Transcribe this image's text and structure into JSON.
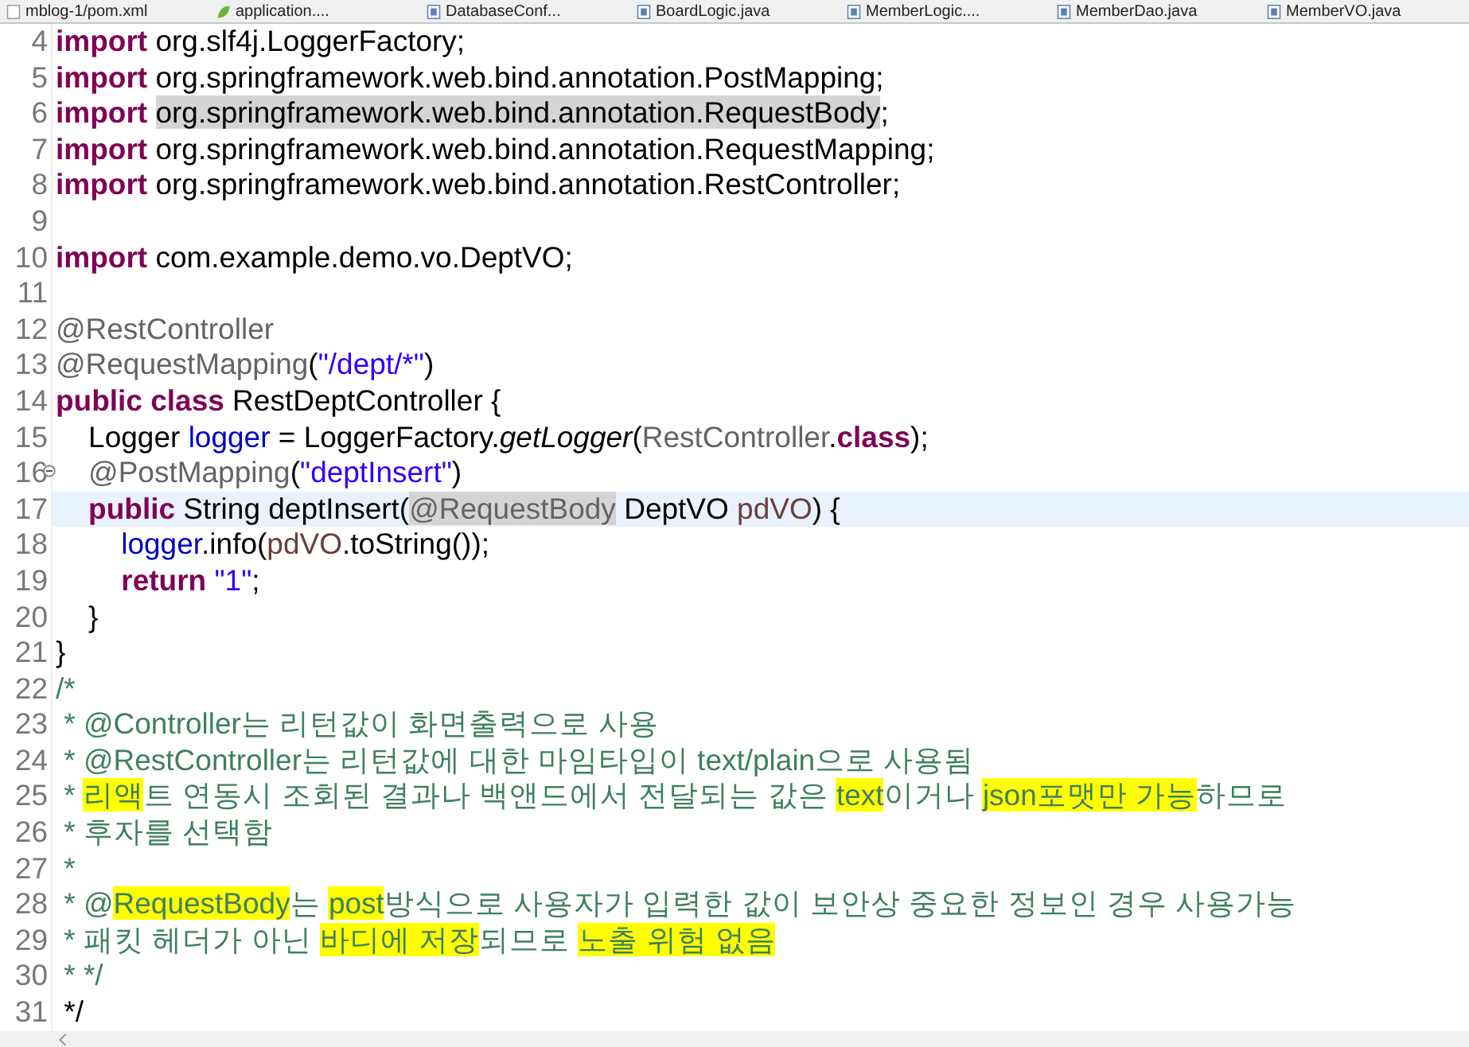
{
  "editor_tabs": [
    {
      "label": "mblog-1/pom.xml",
      "kind": "xml"
    },
    {
      "label": "application....",
      "kind": "spring"
    },
    {
      "label": "DatabaseConf...",
      "kind": "java"
    },
    {
      "label": "BoardLogic.java",
      "kind": "java"
    },
    {
      "label": "MemberLogic....",
      "kind": "java"
    },
    {
      "label": "MemberDao.java",
      "kind": "java"
    },
    {
      "label": "MemberVO.java",
      "kind": "java"
    }
  ],
  "code_lines": [
    {
      "number": "4",
      "current": false,
      "fold": false,
      "tokens": [
        {
          "text": "import ",
          "kind": "keyword"
        },
        {
          "text": "org.slf4j.LoggerFactory;",
          "kind": "plain"
        }
      ]
    },
    {
      "number": "5",
      "current": false,
      "fold": false,
      "tokens": [
        {
          "text": "import ",
          "kind": "keyword"
        },
        {
          "text": "org.springframework.web.bind.annotation.PostMapping;",
          "kind": "plain"
        }
      ]
    },
    {
      "number": "6",
      "current": false,
      "fold": false,
      "tokens": [
        {
          "text": "import ",
          "kind": "keyword"
        },
        {
          "text": "org.springframework.web.bind.annotation.RequestBody",
          "kind": "occurrence"
        },
        {
          "text": ";",
          "kind": "plain"
        }
      ]
    },
    {
      "number": "7",
      "current": false,
      "fold": false,
      "tokens": [
        {
          "text": "import ",
          "kind": "keyword"
        },
        {
          "text": "org.springframework.web.bind.annotation.RequestMapping;",
          "kind": "plain"
        }
      ]
    },
    {
      "number": "8",
      "current": false,
      "fold": false,
      "tokens": [
        {
          "text": "import ",
          "kind": "keyword"
        },
        {
          "text": "org.springframework.web.bind.annotation.RestController;",
          "kind": "plain"
        }
      ]
    },
    {
      "number": "9",
      "current": false,
      "fold": false
    },
    {
      "number": "10",
      "current": false,
      "fold": false,
      "tokens": [
        {
          "text": "import ",
          "kind": "keyword"
        },
        {
          "text": "com.example.demo.vo.DeptVO;",
          "kind": "plain"
        }
      ]
    },
    {
      "number": "11",
      "current": false,
      "fold": false
    },
    {
      "number": "12",
      "current": false,
      "fold": false,
      "tokens": [
        {
          "text": "@RestController",
          "kind": "annotation"
        }
      ]
    },
    {
      "number": "13",
      "current": false,
      "fold": false,
      "tokens": [
        {
          "text": "@RequestMapping",
          "kind": "annotation"
        },
        {
          "text": "(",
          "kind": "plain"
        },
        {
          "text": "\"/dept/*\"",
          "kind": "string"
        },
        {
          "text": ")",
          "kind": "plain"
        }
      ]
    },
    {
      "number": "14",
      "current": false,
      "fold": false,
      "tokens": [
        {
          "text": "public class",
          "kind": "keyword"
        },
        {
          "text": " RestDeptController {",
          "kind": "plain"
        }
      ]
    },
    {
      "number": "15",
      "current": false,
      "fold": false,
      "tokens": [
        {
          "text": "    Logger ",
          "kind": "plain"
        },
        {
          "text": "logger",
          "kind": "field"
        },
        {
          "text": " = LoggerFactory.",
          "kind": "plain"
        },
        {
          "text": "getLogger",
          "kind": "static"
        },
        {
          "text": "(",
          "kind": "plain"
        },
        {
          "text": "RestController",
          "kind": "annotation"
        },
        {
          "text": ".",
          "kind": "plain"
        },
        {
          "text": "class",
          "kind": "keyword"
        },
        {
          "text": ");",
          "kind": "plain"
        }
      ]
    },
    {
      "number": "16",
      "current": false,
      "fold": true,
      "tokens": [
        {
          "text": "    @PostMapping",
          "kind": "annotation"
        },
        {
          "text": "(",
          "kind": "plain"
        },
        {
          "text": "\"deptInsert\"",
          "kind": "string"
        },
        {
          "text": ")",
          "kind": "plain"
        }
      ]
    },
    {
      "number": "17",
      "current": true,
      "fold": false,
      "tokens": [
        {
          "text": "    public",
          "kind": "keyword"
        },
        {
          "text": " String deptInsert(",
          "kind": "plain"
        },
        {
          "text": "@RequestBody",
          "kind": "annotation-occurrence"
        },
        {
          "text": " DeptVO ",
          "kind": "plain"
        },
        {
          "text": "pdVO",
          "kind": "variable"
        },
        {
          "text": ") {",
          "kind": "plain"
        }
      ]
    },
    {
      "number": "18",
      "current": false,
      "fold": false,
      "tokens": [
        {
          "text": "        logger",
          "kind": "field"
        },
        {
          "text": ".info(",
          "kind": "plain"
        },
        {
          "text": "pdVO",
          "kind": "variable"
        },
        {
          "text": ".toString());",
          "kind": "plain"
        }
      ]
    },
    {
      "number": "19",
      "current": false,
      "fold": false,
      "tokens": [
        {
          "text": "        return ",
          "kind": "keyword"
        },
        {
          "text": "\"1\"",
          "kind": "string"
        },
        {
          "text": ";",
          "kind": "plain"
        }
      ]
    },
    {
      "number": "20",
      "current": false,
      "fold": false,
      "tokens": [
        {
          "text": "    }",
          "kind": "plain"
        }
      ]
    },
    {
      "number": "21",
      "current": false,
      "fold": false,
      "tokens": [
        {
          "text": "}",
          "kind": "plain"
        }
      ]
    },
    {
      "number": "22",
      "current": false,
      "fold": false,
      "tokens": [
        {
          "text": "/*",
          "kind": "comment"
        }
      ]
    },
    {
      "number": "23",
      "current": false,
      "fold": false,
      "tokens": [
        {
          "text": " * @Controller는 리턴값이 화면출력으로 사용",
          "kind": "comment"
        }
      ]
    },
    {
      "number": "24",
      "current": false,
      "fold": false,
      "tokens": [
        {
          "text": " * @RestController는 리턴값에 대한 마임타입이 text/plain으로 사용됨",
          "kind": "comment"
        }
      ]
    },
    {
      "number": "25",
      "current": false,
      "fold": false,
      "tokens": [
        {
          "text": " * ",
          "kind": "comment"
        },
        {
          "text": "리액",
          "kind": "comment-highlight"
        },
        {
          "text": "트 연동시 조회된 결과나 백앤드에서 전달되는 값은 ",
          "kind": "comment"
        },
        {
          "text": "text",
          "kind": "comment-highlight"
        },
        {
          "text": "이거나 ",
          "kind": "comment"
        },
        {
          "text": "json포맷만 가능",
          "kind": "comment-highlight"
        },
        {
          "text": "하므로",
          "kind": "comment"
        }
      ]
    },
    {
      "number": "26",
      "current": false,
      "fold": false,
      "tokens": [
        {
          "text": " * 후자를 선택함",
          "kind": "comment"
        }
      ]
    },
    {
      "number": "27",
      "current": false,
      "fold": false,
      "tokens": [
        {
          "text": " *",
          "kind": "comment"
        }
      ]
    },
    {
      "number": "28",
      "current": false,
      "fold": false,
      "tokens": [
        {
          "text": " * @",
          "kind": "comment"
        },
        {
          "text": "RequestBody",
          "kind": "comment-highlight"
        },
        {
          "text": "는 ",
          "kind": "comment"
        },
        {
          "text": "post",
          "kind": "comment-highlight"
        },
        {
          "text": "방식으로 사용자가 입력한 값이 보안상 중요한 정보인 경우 사용가능",
          "kind": "comment"
        }
      ]
    },
    {
      "number": "29",
      "current": false,
      "fold": false,
      "tokens": [
        {
          "text": " * 패킷 헤더가 아닌 ",
          "kind": "comment"
        },
        {
          "text": "바디에 저장",
          "kind": "comment-highlight"
        },
        {
          "text": "되므로 ",
          "kind": "comment"
        },
        {
          "text": "노출 위험 없음",
          "kind": "comment-highlight"
        }
      ]
    },
    {
      "number": "30",
      "current": false,
      "fold": false,
      "tokens": [
        {
          "text": " * */",
          "kind": "comment"
        }
      ]
    },
    {
      "number": "31",
      "current": false,
      "fold": false,
      "tokens": [
        {
          "text": " */",
          "kind": "plain"
        }
      ]
    }
  ]
}
